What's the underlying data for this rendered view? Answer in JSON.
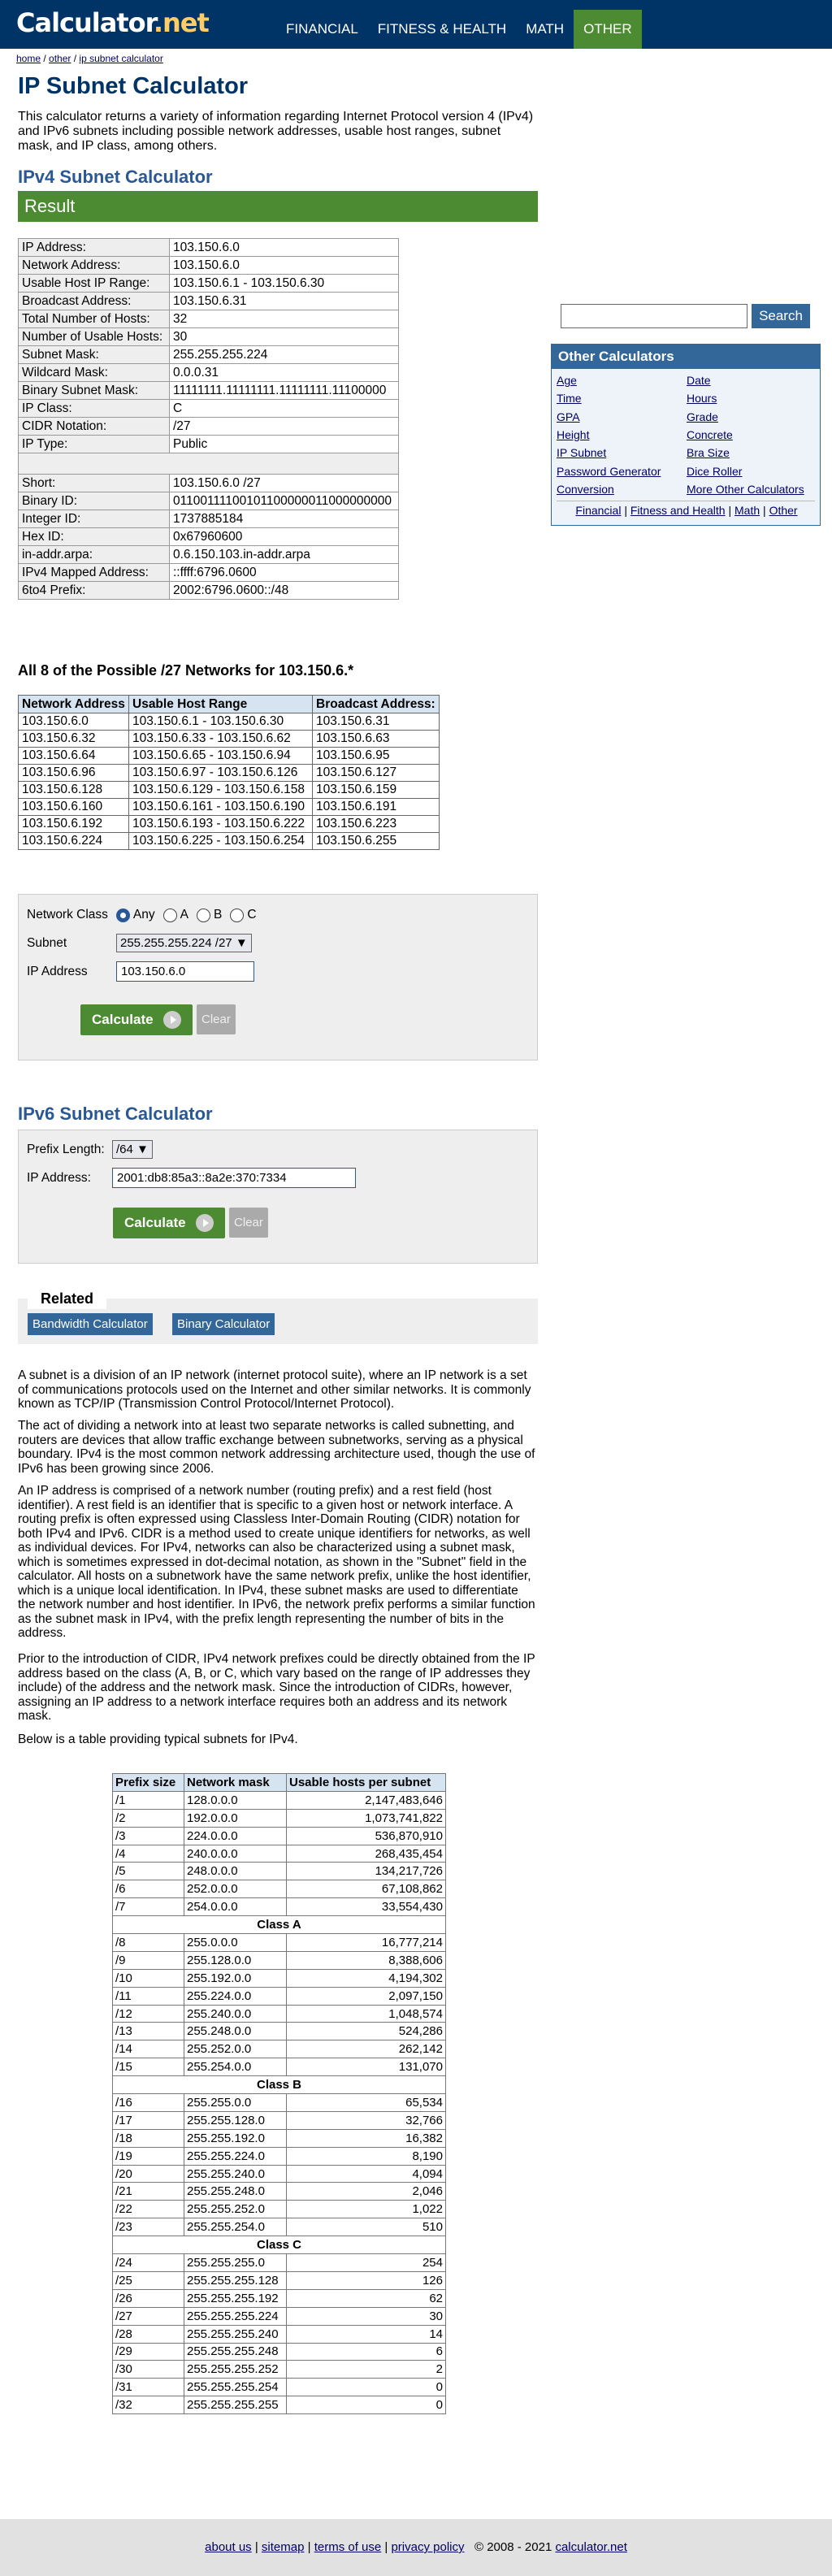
{
  "logo": {
    "main": "Calculator",
    "dot": ".",
    "tld": "net"
  },
  "topnav": [
    "FINANCIAL",
    "FITNESS & HEALTH",
    "MATH",
    "OTHER"
  ],
  "breadcrumb": {
    "home": "home",
    "sep": " / ",
    "other": "other",
    "current": "ip subnet calculator"
  },
  "title": "IP Subnet Calculator",
  "intro": "This calculator returns a variety of information regarding Internet Protocol version 4 (IPv4) and IPv6 subnets including possible network addresses, usable host ranges, subnet mask, and IP class, among others.",
  "ipv4_heading": "IPv4 Subnet Calculator",
  "result_label": "Result",
  "result_rows": [
    {
      "k": "IP Address:",
      "v": "103.150.6.0"
    },
    {
      "k": "Network Address:",
      "v": "103.150.6.0"
    },
    {
      "k": "Usable Host IP Range:",
      "v": "103.150.6.1 - 103.150.6.30"
    },
    {
      "k": "Broadcast Address:",
      "v": "103.150.6.31"
    },
    {
      "k": "Total Number of Hosts:",
      "v": "32"
    },
    {
      "k": "Number of Usable Hosts:",
      "v": "30"
    },
    {
      "k": "Subnet Mask:",
      "v": "255.255.255.224"
    },
    {
      "k": "Wildcard Mask:",
      "v": "0.0.0.31"
    },
    {
      "k": "Binary Subnet Mask:",
      "v": "11111111.11111111.11111111.11100000"
    },
    {
      "k": "IP Class:",
      "v": "C"
    },
    {
      "k": "CIDR Notation:",
      "v": "/27"
    },
    {
      "k": "IP Type:",
      "v": "Public"
    }
  ],
  "result_rows2": [
    {
      "k": "Short:",
      "v": "103.150.6.0 /27"
    },
    {
      "k": "Binary ID:",
      "v": "01100111100101100000011000000000"
    },
    {
      "k": "Integer ID:",
      "v": "1737885184"
    },
    {
      "k": "Hex ID:",
      "v": "0x67960600"
    },
    {
      "k": "in-addr.arpa:",
      "v": "0.6.150.103.in-addr.arpa"
    },
    {
      "k": "IPv4 Mapped Address:",
      "v": "::ffff:6796.0600"
    },
    {
      "k": "6to4 Prefix:",
      "v": "2002:6796.0600::/48"
    }
  ],
  "networks_heading": "All 8 of the Possible /27 Networks for 103.150.6.*",
  "networks_cols": [
    "Network Address",
    "Usable Host Range",
    "Broadcast Address:"
  ],
  "networks": [
    [
      "103.150.6.0",
      "103.150.6.1 - 103.150.6.30",
      "103.150.6.31"
    ],
    [
      "103.150.6.32",
      "103.150.6.33 - 103.150.6.62",
      "103.150.6.63"
    ],
    [
      "103.150.6.64",
      "103.150.6.65 - 103.150.6.94",
      "103.150.6.95"
    ],
    [
      "103.150.6.96",
      "103.150.6.97 - 103.150.6.126",
      "103.150.6.127"
    ],
    [
      "103.150.6.128",
      "103.150.6.129 - 103.150.6.158",
      "103.150.6.159"
    ],
    [
      "103.150.6.160",
      "103.150.6.161 - 103.150.6.190",
      "103.150.6.191"
    ],
    [
      "103.150.6.192",
      "103.150.6.193 - 103.150.6.222",
      "103.150.6.223"
    ],
    [
      "103.150.6.224",
      "103.150.6.225 - 103.150.6.254",
      "103.150.6.255"
    ]
  ],
  "ipv4form": {
    "class_label": "Network Class",
    "classes": [
      "Any",
      "A",
      "B",
      "C"
    ],
    "selected_class": "Any",
    "subnet_label": "Subnet",
    "subnet_value": "255.255.255.224 /27",
    "ip_label": "IP Address",
    "ip_value": "103.150.6.0",
    "calc": "Calculate",
    "clear": "Clear"
  },
  "ipv6_heading": "IPv6 Subnet Calculator",
  "ipv6form": {
    "prefix_label": "Prefix Length:",
    "prefix_value": "/64",
    "ip_label": "IP Address:",
    "ip_value": "2001:db8:85a3::8a2e:370:7334",
    "calc": "Calculate",
    "clear": "Clear"
  },
  "related": {
    "label": "Related",
    "links": [
      "Bandwidth Calculator",
      "Binary Calculator"
    ]
  },
  "paragraphs": [
    "A subnet is a division of an IP network (internet protocol suite), where an IP network is a set of communications protocols used on the Internet and other similar networks. It is commonly known as TCP/IP (Transmission Control Protocol/Internet Protocol).",
    "The act of dividing a network into at least two separate networks is called subnetting, and routers are devices that allow traffic exchange between subnetworks, serving as a physical boundary. IPv4 is the most common network addressing architecture used, though the use of IPv6 has been growing since 2006.",
    "An IP address is comprised of a network number (routing prefix) and a rest field (host identifier). A rest field is an identifier that is specific to a given host or network interface. A routing prefix is often expressed using Classless Inter-Domain Routing (CIDR) notation for both IPv4 and IPv6. CIDR is a method used to create unique identifiers for networks, as well as individual devices. For IPv4, networks can also be characterized using a subnet mask, which is sometimes expressed in dot-decimal notation, as shown in the \"Subnet\" field in the calculator. All hosts on a subnetwork have the same network prefix, unlike the host identifier, which is a unique local identification. In IPv4, these subnet masks are used to differentiate the network number and host identifier. In IPv6, the network prefix performs a similar function as the subnet mask in IPv4, with the prefix length representing the number of bits in the address.",
    "Prior to the introduction of CIDR, IPv4 network prefixes could be directly obtained from the IP address based on the class (A, B, or C, which vary based on the range of IP addresses they include) of the address and the network mask. Since the introduction of CIDRs, however, assigning an IP address to a network interface requires both an address and its network mask.",
    "Below is a table providing typical subnets for IPv4."
  ],
  "subnet_cols": [
    "Prefix size",
    "Network mask",
    "Usable hosts per subnet"
  ],
  "subnet_rows": [
    [
      "/1",
      "128.0.0.0",
      "2,147,483,646"
    ],
    [
      "/2",
      "192.0.0.0",
      "1,073,741,822"
    ],
    [
      "/3",
      "224.0.0.0",
      "536,870,910"
    ],
    [
      "/4",
      "240.0.0.0",
      "268,435,454"
    ],
    [
      "/5",
      "248.0.0.0",
      "134,217,726"
    ],
    [
      "/6",
      "252.0.0.0",
      "67,108,862"
    ],
    [
      "/7",
      "254.0.0.0",
      "33,554,430"
    ],
    [
      "Class A"
    ],
    [
      "/8",
      "255.0.0.0",
      "16,777,214"
    ],
    [
      "/9",
      "255.128.0.0",
      "8,388,606"
    ],
    [
      "/10",
      "255.192.0.0",
      "4,194,302"
    ],
    [
      "/11",
      "255.224.0.0",
      "2,097,150"
    ],
    [
      "/12",
      "255.240.0.0",
      "1,048,574"
    ],
    [
      "/13",
      "255.248.0.0",
      "524,286"
    ],
    [
      "/14",
      "255.252.0.0",
      "262,142"
    ],
    [
      "/15",
      "255.254.0.0",
      "131,070"
    ],
    [
      "Class B"
    ],
    [
      "/16",
      "255.255.0.0",
      "65,534"
    ],
    [
      "/17",
      "255.255.128.0",
      "32,766"
    ],
    [
      "/18",
      "255.255.192.0",
      "16,382"
    ],
    [
      "/19",
      "255.255.224.0",
      "8,190"
    ],
    [
      "/20",
      "255.255.240.0",
      "4,094"
    ],
    [
      "/21",
      "255.255.248.0",
      "2,046"
    ],
    [
      "/22",
      "255.255.252.0",
      "1,022"
    ],
    [
      "/23",
      "255.255.254.0",
      "510"
    ],
    [
      "Class C"
    ],
    [
      "/24",
      "255.255.255.0",
      "254"
    ],
    [
      "/25",
      "255.255.255.128",
      "126"
    ],
    [
      "/26",
      "255.255.255.192",
      "62"
    ],
    [
      "/27",
      "255.255.255.224",
      "30"
    ],
    [
      "/28",
      "255.255.255.240",
      "14"
    ],
    [
      "/29",
      "255.255.255.248",
      "6"
    ],
    [
      "/30",
      "255.255.255.252",
      "2"
    ],
    [
      "/31",
      "255.255.255.254",
      "0"
    ],
    [
      "/32",
      "255.255.255.255",
      "0"
    ]
  ],
  "search": {
    "button": "Search",
    "value": ""
  },
  "other_calcs": {
    "title": "Other Calculators",
    "col1": [
      "Age",
      "Time",
      "GPA",
      "Height",
      "IP Subnet",
      "Password Generator",
      "Conversion"
    ],
    "col2": [
      "Date",
      "Hours",
      "Grade",
      "Concrete",
      "Bra Size",
      "Dice Roller",
      "More Other Calculators"
    ],
    "footer_links": [
      "Financial",
      "Fitness and Health",
      "Math",
      "Other"
    ],
    "sep": " | "
  },
  "footer": {
    "links": [
      "about us",
      "sitemap",
      "terms of use",
      "privacy policy"
    ],
    "sep": " | ",
    "copyright": "© 2008 - 2021 ",
    "site": "calculator.net"
  },
  "colors": {
    "header": "#003366",
    "green": "#4c8b32",
    "blue": "#336699",
    "heading": "#2a5896"
  }
}
